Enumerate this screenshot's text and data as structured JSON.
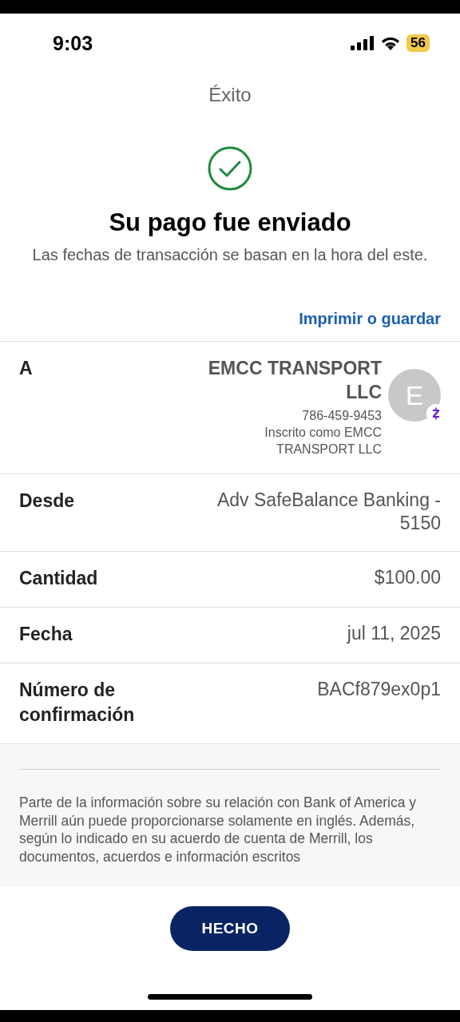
{
  "status_bar": {
    "time": "9:03",
    "battery": "56"
  },
  "header": {
    "title": "Éxito"
  },
  "result": {
    "heading": "Su pago fue enviado",
    "note": "Las fechas de transacción se basan en la hora del este."
  },
  "print_link": "Imprimir o guardar",
  "recipient": {
    "label": "A",
    "name": "EMCC TRANSPORT LLC",
    "phone": "786-459-9453",
    "enrolled": "Inscrito como EMCC TRANSPORT LLC",
    "avatar_letter": "E"
  },
  "details": [
    {
      "label": "Desde",
      "value": "Adv SafeBalance Banking - 5150"
    },
    {
      "label": "Cantidad",
      "value": "$100.00"
    },
    {
      "label": "Fecha",
      "value": "jul 11, 2025"
    },
    {
      "label": "Número de confirmación",
      "value": "BACf879ex0p1"
    }
  ],
  "disclaimer": "Parte de la información sobre su relación con Bank of America y Merrill aún puede proporcionarse solamente en inglés. Además, según lo indicado en su acuerdo de cuenta de Merrill, los documentos, acuerdos e información escritos",
  "done_button": "HECHO"
}
